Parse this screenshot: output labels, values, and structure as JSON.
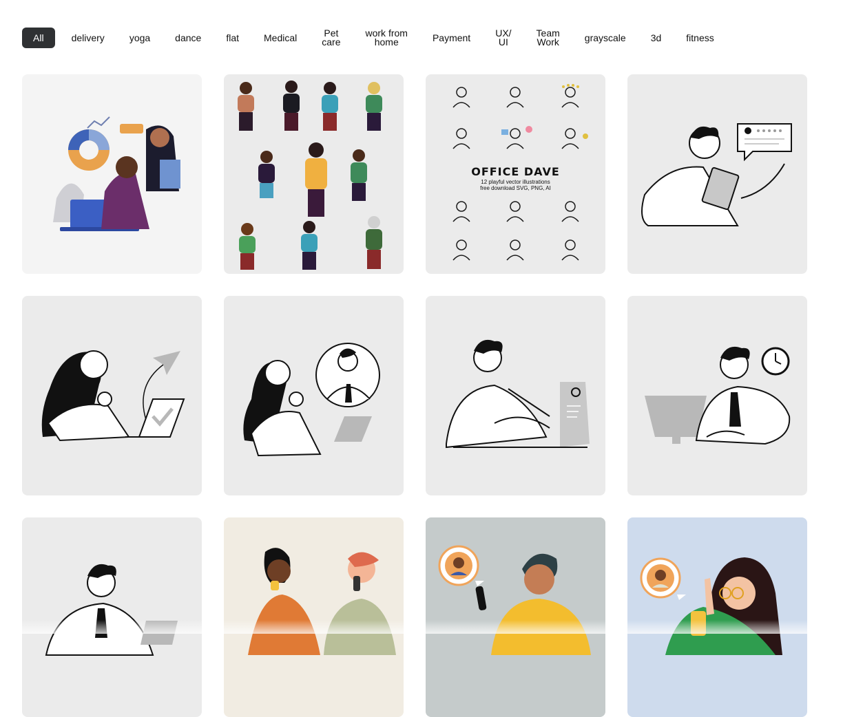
{
  "filters": [
    {
      "label": "All",
      "active": true
    },
    {
      "label": "delivery"
    },
    {
      "label": "yoga"
    },
    {
      "label": "dance"
    },
    {
      "label": "flat"
    },
    {
      "label": "Medical"
    },
    {
      "label": "Pet\ncare"
    },
    {
      "label": "work from\nhome"
    },
    {
      "label": "Payment"
    },
    {
      "label": "UX/\nUI"
    },
    {
      "label": "Team\nWork"
    },
    {
      "label": "grayscale"
    },
    {
      "label": "3d"
    },
    {
      "label": "fitness"
    }
  ],
  "cards": {
    "office_dave": {
      "title": "OFFICE DAVE",
      "subtitle": "12 playful vector illustrations\nfree download SVG, PNG, AI"
    }
  },
  "colors": {
    "active_chip": "#2f3133",
    "card_bg": "#ebebeb"
  }
}
